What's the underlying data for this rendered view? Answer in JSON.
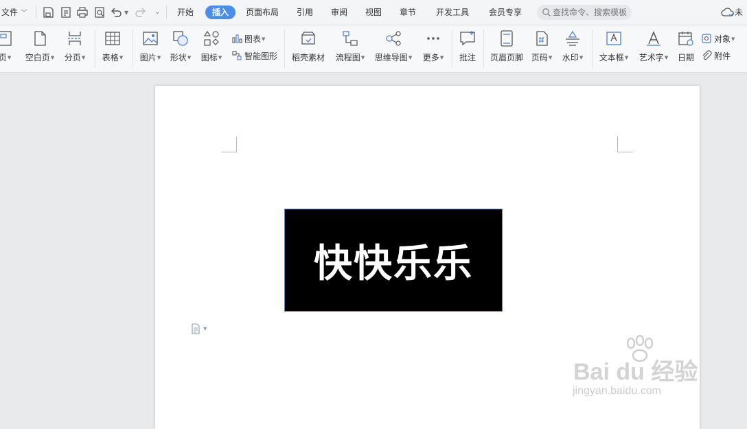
{
  "tabbar": {
    "file_label": "文件",
    "tabs": [
      {
        "label": "开始",
        "active": false
      },
      {
        "label": "插入",
        "active": true
      },
      {
        "label": "页面布局",
        "active": false
      },
      {
        "label": "引用",
        "active": false
      },
      {
        "label": "审阅",
        "active": false
      },
      {
        "label": "视图",
        "active": false
      },
      {
        "label": "章节",
        "active": false
      },
      {
        "label": "开发工具",
        "active": false
      },
      {
        "label": "会员专享",
        "active": false
      }
    ],
    "search_placeholder": "查找命令、搜索模板",
    "cloud_label": "未"
  },
  "ribbon": {
    "cover_page": "页",
    "blank_page": "空白页",
    "page_break": "分页",
    "table": "表格",
    "picture": "图片",
    "shape": "形状",
    "icon": "图标",
    "chart": "图表",
    "smart_art": "智能图形",
    "docer_material": "稻壳素材",
    "flowchart": "流程图",
    "mind_map": "思维导图",
    "more": "更多",
    "comment": "批注",
    "header_footer": "页眉页脚",
    "page_number": "页码",
    "watermark": "水印",
    "text_box": "文本框",
    "word_art": "艺术字",
    "date": "日期",
    "object": "对象",
    "attachment": "附件"
  },
  "document": {
    "textbox_text": "快快乐乐"
  },
  "watermark": {
    "main": "Bai du 经验",
    "sub": "jingyan.baidu.com"
  },
  "colors": {
    "accent": "#4a8ee8",
    "icon_blue": "#4a7fd6",
    "textbox_bg": "#000000",
    "textbox_fg": "#ffffff"
  }
}
